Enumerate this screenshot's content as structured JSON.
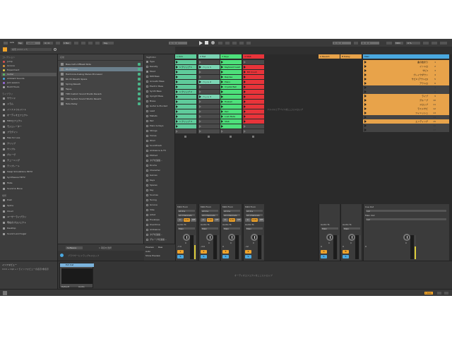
{
  "topbar": {
    "link_label": "Link",
    "tap_label": "Tap",
    "tempo": "120.00",
    "time_sig": "4 / 4",
    "quant": "1 Bar",
    "metro_label": "",
    "position": "1 . 1 . 1",
    "loop_start": "1 . 1 . 1",
    "loop_len": "4 . 0 . 0",
    "key_label": "Key",
    "midi_label": "MIDI",
    "cpu": "0 %",
    "accent": "#f0a32a"
  },
  "browser": {
    "search_placeholder": "検索 (Cmd + F)",
    "categories_header": "コレクション",
    "collections": [
      {
        "label": "Jump",
        "color": "#e05050"
      },
      {
        "label": "Groove",
        "color": "#e89a3a"
      },
      {
        "label": "Experiment",
        "color": "#e6d14a"
      },
      {
        "label": "Guitar",
        "color": "#56c06a"
      },
      {
        "label": "Ambient Sounds",
        "color": "#4aa8e0"
      },
      {
        "label": "Jam session",
        "color": "#9a6ae0"
      },
      {
        "label": "Build Hours",
        "color": "#b0b0b0"
      }
    ],
    "library_header": "ライブラリ",
    "library": [
      {
        "label": "サウンド"
      },
      {
        "label": "ドラム"
      },
      {
        "label": "インストゥルメント"
      },
      {
        "label": "オーディオエフェクト"
      },
      {
        "label": "MIDIエフェクト"
      },
      {
        "label": "モジュレーター"
      },
      {
        "label": "プラグイン"
      },
      {
        "label": "Max for Live"
      },
      {
        "label": "クリップ"
      },
      {
        "label": "サンプル"
      },
      {
        "label": "グルーヴ"
      },
      {
        "label": "チューニング"
      },
      {
        "label": "テンプレート"
      },
      {
        "label": "Sleep Simulations HDT2"
      },
      {
        "label": "Synthwave HDT2"
      },
      {
        "label": "Mute"
      },
      {
        "label": "Sound & Move"
      }
    ],
    "places_header": "場所",
    "places": [
      {
        "label": "Push"
      },
      {
        "label": "Splice"
      },
      {
        "label": "Cloud"
      },
      {
        "label": "ユーザーライブラリ"
      },
      {
        "label": "現在のプロジェクト"
      },
      {
        "label": "Desktop"
      },
      {
        "label": "Sound Land Sugar"
      }
    ],
    "name_header": "名前",
    "files": [
      {
        "label": "Bass Cat's Offbeat Slide",
        "selected": false
      },
      {
        "label": "DS Phrases",
        "selected": true
      },
      {
        "label": "Harmonia Analog Stereo Processor",
        "selected": false
      },
      {
        "label": "KC-33 Reverb Space",
        "selected": false
      },
      {
        "label": "Spring Reverb",
        "selected": false
      },
      {
        "label": "Tapes",
        "selected": false
      },
      {
        "label": "TR8 Custom Sound Studio Reverb",
        "selected": false
      },
      {
        "label": "TR8 System Sound Studio Reverb",
        "selected": false
      },
      {
        "label": "Tube Delay",
        "selected": false
      }
    ],
    "footer_left": "Software",
    "footer_right": "1 項目を選択",
    "footer_hint": "ブラウザーにドラッグ&ドロップ",
    "tags_header": "TagEditor",
    "tags": [
      {
        "label": "Type",
        "checked": true
      },
      {
        "label": "Density",
        "checked": false
      },
      {
        "label": "Mood",
        "checked": true
      },
      {
        "label": "808 Bass",
        "checked": false
      },
      {
        "label": "Acoustic Bass",
        "checked": false
      },
      {
        "label": "Electric Bass",
        "checked": false
      },
      {
        "label": "Synth Bass",
        "checked": false
      },
      {
        "label": "Upright Bass",
        "checked": false
      },
      {
        "label": "Brass",
        "checked": false
      },
      {
        "label": "Guitar & Plucked",
        "checked": false
      },
      {
        "label": "Lead",
        "checked": false
      },
      {
        "label": "Mallets",
        "checked": false
      },
      {
        "label": "Pad",
        "checked": false
      },
      {
        "label": "Piano & Keys",
        "checked": false
      },
      {
        "label": "Strings",
        "checked": false
      },
      {
        "label": "Voices",
        "checked": false
      },
      {
        "label": "Wind",
        "checked": false
      },
      {
        "label": "Soundtrack",
        "checked": false
      },
      {
        "label": "Ambience & FX",
        "checked": false
      },
      {
        "label": "Pitched",
        "checked": false
      },
      {
        "label": "タグを追加...",
        "checked": false
      },
      {
        "label": "Drums",
        "checked": false
      },
      {
        "label": "Character",
        "checked": false
      },
      {
        "label": "Genres",
        "checked": false
      },
      {
        "label": "Keys",
        "checked": false
      },
      {
        "label": "Spaces",
        "checked": false
      },
      {
        "label": "Key",
        "checked": false
      },
      {
        "label": "Sources",
        "checked": false
      },
      {
        "label": "Tuning",
        "checked": false
      },
      {
        "label": "Groove",
        "checked": false
      },
      {
        "label": "Vibe",
        "checked": false
      },
      {
        "label": "Artist",
        "checked": false
      },
      {
        "label": "Envelope",
        "checked": false
      },
      {
        "label": "Overdrive",
        "checked": false
      },
      {
        "label": "Ambience",
        "checked": false
      },
      {
        "label": "タグを追加...",
        "checked": false
      },
      {
        "label": "グループを追加...",
        "checked": false
      }
    ],
    "tag_footer_a": "Preview",
    "tag_footer_b": "Raw",
    "tag_footer_c": "Auto",
    "tag_footer_d": "Show Preview"
  },
  "session": {
    "drop_hint": "ファイルとデバイスをここにドロップ",
    "tracks": [
      {
        "name": "1 Kick",
        "color": "#5fcb9b"
      },
      {
        "name": "2 Hat",
        "color": "#7ad3b3"
      },
      {
        "name": "3 Keys",
        "color": "#4de07a"
      },
      {
        "name": "4 Stab",
        "color": "#e8343a"
      }
    ],
    "returns": [
      {
        "name": "A Reverb",
        "color": "#e8a34a"
      },
      {
        "name": "B Delay",
        "color": "#e8a34a"
      }
    ],
    "master_name": "Main",
    "master_color": "#4aa8e0",
    "clips_t1": [
      "",
      "1 クリップ 1",
      "",
      "",
      "",
      "",
      "1 クリップ 2",
      "",
      "",
      "",
      "",
      "",
      "1 クリップ 3",
      "",
      ""
    ],
    "clips_t2": [
      "",
      "ハット 1",
      "",
      "",
      "ハット 2",
      "",
      "",
      "ハット 3",
      "",
      "",
      "",
      "",
      "",
      "",
      ""
    ],
    "clips_t3": [
      "",
      "Keyboard Lead",
      "",
      "Reprise",
      "Piano",
      "Crystal Bell",
      "",
      "",
      "Fireball",
      "",
      "Pad",
      "Lush Bells",
      "Stab",
      "",
      ""
    ],
    "clips_t4": [
      "",
      "",
      "Bit Crush Flanger",
      "",
      "",
      "",
      "",
      "",
      "",
      "",
      "",
      "",
      "",
      "",
      ""
    ],
    "master_scenes": [
      {
        "name": "曲の始まり",
        "num": "1"
      },
      {
        "name": "イントロ",
        "num": "2"
      },
      {
        "name": "サビ1",
        "num": "3"
      },
      {
        "name": "ブレイクダウン",
        "num": "4"
      },
      {
        "name": "サビ2 (アウトロ)",
        "num": "5"
      },
      {
        "name": "アウトロ",
        "num": "6"
      },
      {
        "name": "",
        "num": "7"
      },
      {
        "name": "",
        "num": "8"
      },
      {
        "name": "ライブ",
        "num": "9"
      },
      {
        "name": "グループ",
        "num": "10"
      },
      {
        "name": "ドロップ",
        "num": "11"
      },
      {
        "name": "ラストサビ",
        "num": "12"
      },
      {
        "name": "フィニッシュ",
        "num": "13"
      },
      {
        "name": "",
        "num": "14"
      },
      {
        "name": "エンディング",
        "num": "15"
      },
      {
        "name": "",
        "num": "16"
      },
      {
        "name": "",
        "num": "17"
      }
    ],
    "mixer": {
      "midi_from": "MIDI From",
      "all_ins": "All Ins",
      "all_channels": "All Channels",
      "monitor_in": "In",
      "monitor_auto": "Auto",
      "monitor_off": "Off",
      "audio_to": "Audio To",
      "main": "Main",
      "sends_label": "Sends",
      "cue_out": "Cue Out",
      "main_out": "Main Out",
      "ext": "1/2",
      "vol_values": [
        "-7.0",
        "-3.6",
        "0",
        "-12",
        "0",
        "0",
        "0"
      ],
      "pan_labels": [
        "C",
        "C",
        "C",
        "C",
        "C",
        "C",
        "C"
      ],
      "track_nums": [
        "1",
        "2",
        "3",
        "4",
        "A",
        "B"
      ]
    }
  },
  "info": {
    "title": "インフォビュー",
    "body": "Cmd + Opt + I でインフォビューの表示/非表示",
    "device_title": "Ext Inst",
    "device_sub_a": "Default",
    "device_sub_b": "Audio"
  },
  "detail": {
    "hint": "オーディオエフェクトをここにドロップ",
    "clip_hint": "クリップをここにドロップ"
  },
  "status": {
    "left_label": "",
    "right_label": "1 Kick"
  }
}
